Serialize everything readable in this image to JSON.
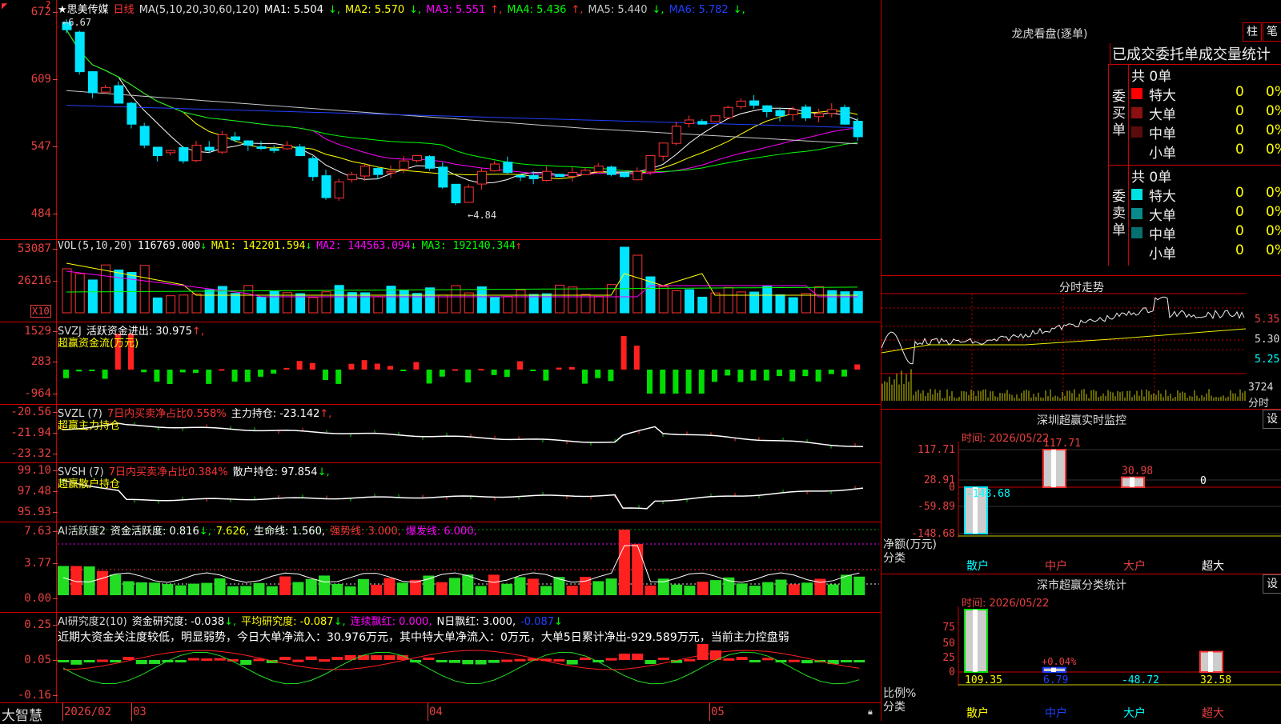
{
  "kline": {
    "star": "★",
    "stock_name": "思美传媒",
    "period": "日线",
    "ma_label": "MA(5,10,20,30,60,120)",
    "ma": [
      {
        "label": "MA1:",
        "value": "5.504",
        "arrow": "↓",
        "color": "#ffffff"
      },
      {
        "label": "MA2:",
        "value": "5.570",
        "arrow": "↓",
        "color": "#ffff00"
      },
      {
        "label": "MA3:",
        "value": "5.551",
        "arrow": "↑",
        "color": "#ff00ff"
      },
      {
        "label": "MA4:",
        "value": "5.436",
        "arrow": "↑",
        "color": "#00ff00"
      },
      {
        "label": "MA5:",
        "value": "5.440",
        "arrow": "↓",
        "color": "#c8c8c8"
      },
      {
        "label": "MA6:",
        "value": "5.782",
        "arrow": "↓",
        "color": "#2040ff"
      }
    ],
    "ticks": [
      "672",
      "609",
      "547",
      "484"
    ],
    "high_label": "6.67",
    "low_label": "←4.84"
  },
  "vol": {
    "header": "VOL(5,10,20)",
    "value": "116769.000",
    "ma1": "MA1: 142201.594",
    "ma2": "MA2: 144563.094",
    "ma3": "MA3: 192140.344",
    "ticks": [
      "53087",
      "26216"
    ],
    "unit": "X10"
  },
  "svzj": {
    "header": "SVZJ",
    "line1": "活跃资金进出: 30.975",
    "line2": "超赢资金流(万元)",
    "ticks": [
      "1529",
      "283",
      "-964"
    ]
  },
  "svzl": {
    "header": "SVZL (7)",
    "ratio": "7日内买卖净占比0.558%",
    "hold": "主力持仓: -23.142",
    "sub": "超赢主力持仓",
    "ticks": [
      "-20.56",
      "-21.94",
      "-23.32"
    ]
  },
  "svsh": {
    "header": "SVSH (7)",
    "ratio": "7日内买卖净占比0.384%",
    "hold": "散户持仓: 97.854",
    "sub": "超赢散户持仓",
    "ticks": [
      "99.10",
      "97.48",
      "95.93"
    ]
  },
  "ai1": {
    "header": "AI活跃度2",
    "a": "资金活跃度: 0.816",
    "b": "7.626",
    "c": "生命线: 1.560",
    "d": "强势线: 3.000",
    "e": "爆发线: 6.000",
    "ticks": [
      "7.63",
      "3.77",
      "0.00"
    ]
  },
  "ai2": {
    "header": "AI研究度2(10)",
    "a": "资金研究度: -0.038",
    "b": "平均研究度: -0.087",
    "c": "连续飘红: 0.000",
    "d": "N日飘红: 3.000",
    "e": "-0.087",
    "comment": "近期大资金关注度较低，明显弱势，今日大单净流入：30.976万元，其中特大单净流入：0万元，大单5日累计净出-929.589万元，当前主力控盘弱",
    "ticks": [
      "0.25",
      "0.05",
      "-0.16"
    ]
  },
  "dates": {
    "brand": "大智慧",
    "d1": "2026/02",
    "d2": "03",
    "d3": "04",
    "d4": "05"
  },
  "longhu": {
    "title": "龙虎看盘(逐单)",
    "btn1": "柱",
    "btn2": "笔",
    "stat_title": "已成交委托单成交量统计",
    "buy_side": "委买单",
    "sell_side": "委卖单",
    "buy_total": "共 0单",
    "sell_total": "共 0单",
    "rows": [
      {
        "label": "特大",
        "count": "0",
        "pct": "0%"
      },
      {
        "label": "大单",
        "count": "0",
        "pct": "0%"
      },
      {
        "label": "中单",
        "count": "0",
        "pct": "0%"
      },
      {
        "label": "小单",
        "count": "0",
        "pct": "0%"
      }
    ]
  },
  "intraday": {
    "title": "分时走势",
    "prices": [
      "5.35",
      "5.30",
      "5.25"
    ],
    "vol": "3724",
    "vol_unit": "分时"
  },
  "sz_monitor": {
    "title": "深圳超赢实时监控",
    "btn": "设",
    "date": "时间: 2026/05/22",
    "ticks": [
      "117.71",
      "28.91",
      "0",
      "-59.89",
      "-148.68"
    ],
    "y_label": "净额(万元)",
    "x_label": "分类",
    "bar_values": [
      "-148.68",
      "117.71",
      "30.98",
      "0"
    ],
    "values": [
      -148.68,
      117.71,
      30.98,
      0
    ],
    "categories": [
      "散户",
      "中户",
      "大户",
      "超大"
    ]
  },
  "sz_class": {
    "title": "深市超赢分类统计",
    "btn": "设",
    "date": "时间: 2026/05/22",
    "ticks": [
      "75",
      "50",
      "25",
      "0"
    ],
    "y_label": "比例%",
    "x_label": "分类",
    "values": [
      109.35,
      6.79,
      -48.72,
      32.58
    ],
    "value_labels": [
      "109.35",
      "6.79",
      "-48.72",
      "32.58"
    ],
    "extra": "+0.04%",
    "categories": [
      "散户",
      "中户",
      "大户",
      "超大"
    ]
  }
}
